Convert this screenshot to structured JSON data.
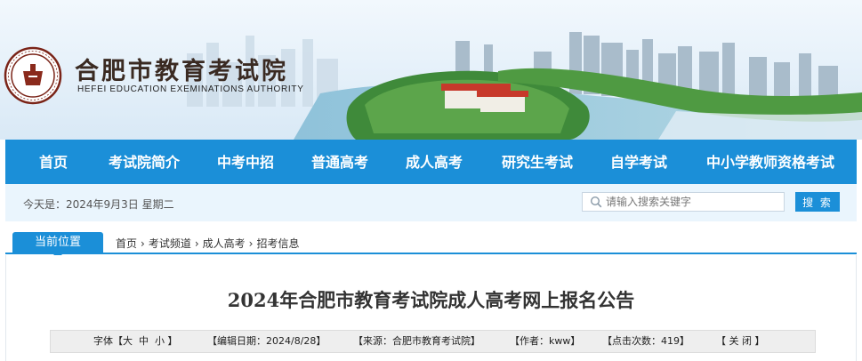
{
  "header": {
    "site_title": "合肥市教育考试院",
    "site_subtitle": "HEFEI EDUCATION EXEMINATIONS AUTHORITY",
    "logo_icon": "seal-logo-icon"
  },
  "nav": {
    "items": [
      {
        "label": "首页"
      },
      {
        "label": "考试院简介"
      },
      {
        "label": "中考中招"
      },
      {
        "label": "普通高考"
      },
      {
        "label": "成人高考"
      },
      {
        "label": "研究生考试"
      },
      {
        "label": "自学考试"
      },
      {
        "label": "中小学教师资格考试"
      }
    ]
  },
  "infobar": {
    "date_text": "今天是：2024年9月3日 星期二",
    "search_placeholder": "请输入搜索关键字",
    "search_button": "搜 索"
  },
  "location": {
    "label": "当前位置",
    "crumbs": [
      "首页",
      "考试频道",
      "成人高考",
      "招考信息"
    ],
    "separator": "›"
  },
  "article": {
    "title": "2024年合肥市教育考试院成人高考网上报名公告",
    "meta": {
      "font_prefix": "字体【",
      "font_large": "大",
      "font_medium": "中",
      "font_small": "小",
      "font_suffix": "】",
      "edit_date": "【编辑日期：2024/8/28】",
      "source": "【来源：合肥市教育考试院】",
      "author": "【作者：kww】",
      "clicks": "【点击次数：419】",
      "close": "【 关 闭 】"
    }
  },
  "colors": {
    "primary_blue": "#1b8fd8",
    "infobar_bg": "#eaf5fd",
    "title_color": "#3a2a22"
  }
}
